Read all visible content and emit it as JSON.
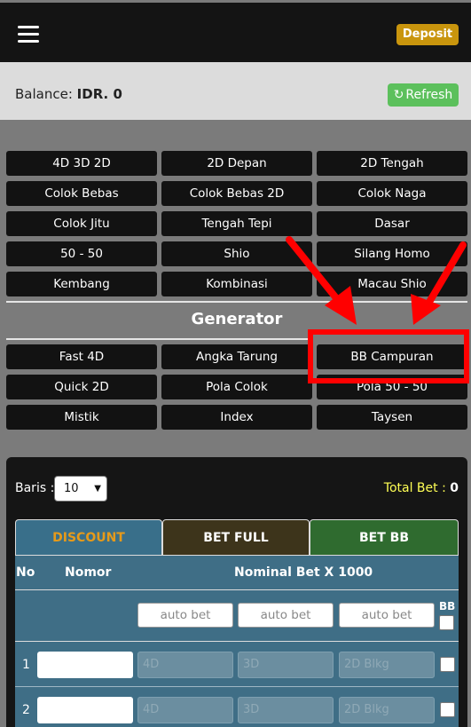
{
  "header": {
    "deposit_label": "Deposit"
  },
  "balance": {
    "label": "Balance:",
    "value": "IDR. 0",
    "refresh_label": "Refresh"
  },
  "menu": {
    "rows": [
      [
        "4D 3D 2D",
        "2D Depan",
        "2D Tengah"
      ],
      [
        "Colok Bebas",
        "Colok Bebas 2D",
        "Colok Naga"
      ],
      [
        "Colok Jitu",
        "Tengah Tepi",
        "Dasar"
      ],
      [
        "50 - 50",
        "Shio",
        "Silang Homo"
      ],
      [
        "Kembang",
        "Kombinasi",
        "Macau Shio"
      ]
    ]
  },
  "generator": {
    "title": "Generator",
    "rows": [
      [
        "Fast 4D",
        "Angka Tarung",
        "BB Campuran"
      ],
      [
        "Quick 2D",
        "Pola Colok",
        "Pola 50 - 50"
      ],
      [
        "Mistik",
        "Index",
        "Taysen"
      ]
    ]
  },
  "bet_panel": {
    "baris_label": "Baris :",
    "baris_value": "10",
    "total_bet_label": "Total Bet :",
    "total_bet_value": "0",
    "tabs": [
      "DISCOUNT",
      "BET FULL",
      "BET BB"
    ],
    "columns": {
      "no": "No",
      "nomor": "Nomor",
      "nominal": "Nominal Bet X 1000",
      "bb": "BB"
    },
    "auto_bet_placeholder": "auto bet",
    "bet_placeholders": [
      "4D",
      "3D",
      "2D Blkg"
    ],
    "rows": [
      "1",
      "2"
    ]
  },
  "colors": {
    "highlight": "#ff0000",
    "deposit": "#c9950d",
    "refresh": "#5cc05c",
    "total_bet": "#ffff55"
  }
}
